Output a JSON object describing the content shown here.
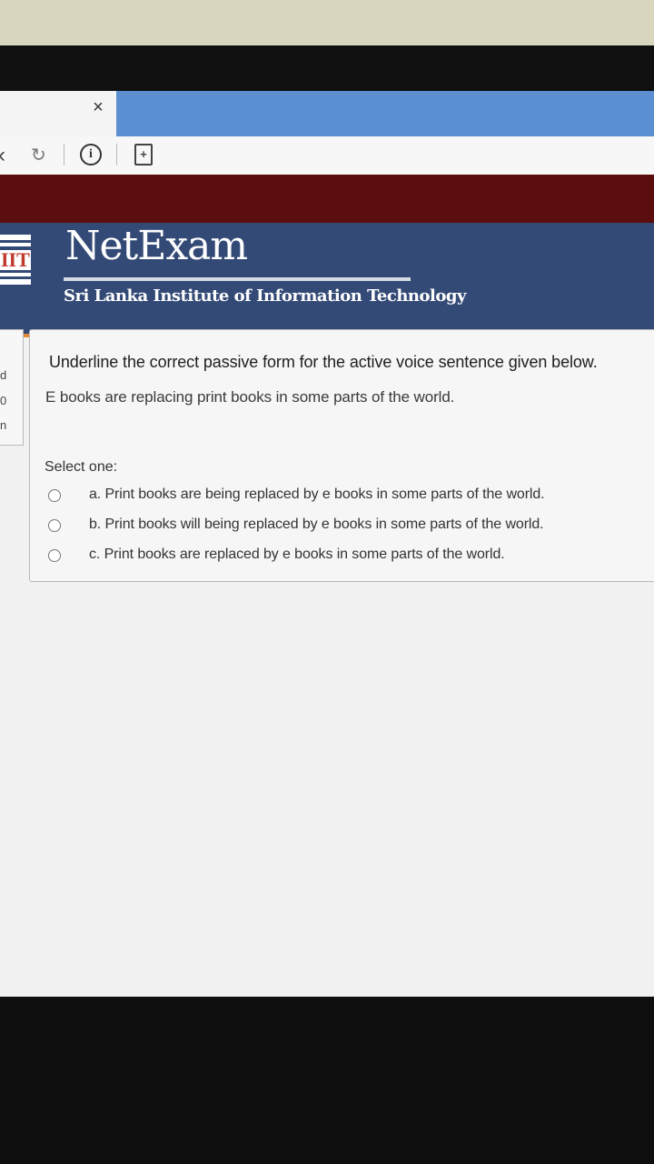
{
  "browser": {
    "tab_close_glyph": "×",
    "back_glyph": "‹",
    "reload_glyph": "↻",
    "info_glyph": "i",
    "page_glyph": "+",
    "accent_tab_color": "#5b8fd1"
  },
  "header": {
    "logo_text": "IIT",
    "app_title": "NetExam",
    "app_subtitle": "Sri Lanka Institute of Information Technology",
    "colors": {
      "header_bg": "#344a76",
      "banner_bg": "#5c0d0d",
      "accent": "#e08a36"
    }
  },
  "side_panel": {
    "fragments": [
      "d",
      "0",
      "n"
    ]
  },
  "question": {
    "prompt": "Underline the correct passive form for the active voice sentence given below.",
    "sentence": "E books are replacing print books in some parts of the world.",
    "select_label": "Select one:",
    "options": [
      {
        "label": "a. Print books are being replaced by e books in some parts of the world.",
        "selected": false
      },
      {
        "label": "b. Print books will being replaced by e books in some parts of the world.",
        "selected": false
      },
      {
        "label": "c. Print books are replaced by e books in some parts of the world.",
        "selected": false
      }
    ]
  }
}
